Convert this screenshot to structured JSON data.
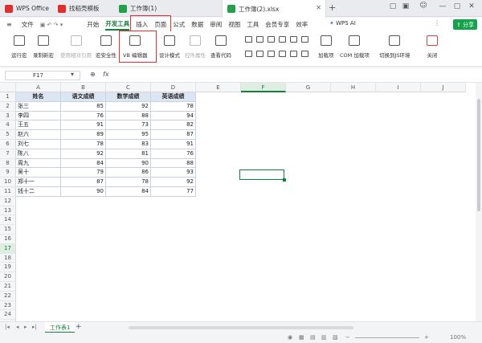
{
  "tabs": [
    {
      "label": "WPS Office",
      "color": "#e02e2e"
    },
    {
      "label": "找稻壳模板",
      "color": "#e02e2e"
    },
    {
      "label": "工作簿(1)",
      "color": "#22a04a"
    },
    {
      "label": "工作簿(2).xlsx",
      "color": "#22a04a"
    }
  ],
  "menu": {
    "file": "文件",
    "items": [
      "开始",
      "开发工具",
      "插入",
      "页面",
      "公式",
      "数据",
      "审阅",
      "视图",
      "工具",
      "会员专享",
      "效率"
    ],
    "active_index": 1,
    "wps_ai": "WPS AI",
    "share": "分享"
  },
  "ribbon": {
    "buttons": [
      {
        "label": "运行宏",
        "disabled": false
      },
      {
        "label": "录制新宏",
        "disabled": false
      },
      {
        "label": "使用相对引用",
        "disabled": true
      },
      {
        "label": "宏安全性",
        "disabled": false
      },
      {
        "label": "VB 编辑器",
        "disabled": false
      },
      {
        "label": "设计模式",
        "disabled": false
      },
      {
        "label": "控件属性",
        "disabled": true
      },
      {
        "label": "查看代码",
        "disabled": false
      },
      {
        "label": "加载项",
        "disabled": false
      },
      {
        "label": "COM 加载项",
        "disabled": false
      },
      {
        "label": "切换到JS环境",
        "disabled": false
      },
      {
        "label": "关闭",
        "disabled": false
      }
    ]
  },
  "formula_bar": {
    "cell_ref": "F17",
    "formula": ""
  },
  "grid": {
    "columns": [
      "A",
      "B",
      "C",
      "D",
      "E",
      "F",
      "G",
      "H",
      "I",
      "J"
    ],
    "selected_column": "F",
    "selected_row": 17,
    "row_count": 25,
    "table": {
      "headers": [
        "姓名",
        "语文成绩",
        "数学成绩",
        "英语成绩"
      ],
      "rows": [
        [
          "张三",
          "85",
          "92",
          "78"
        ],
        [
          "李四",
          "76",
          "88",
          "94"
        ],
        [
          "王五",
          "91",
          "73",
          "82"
        ],
        [
          "赵六",
          "89",
          "95",
          "87"
        ],
        [
          "刘七",
          "78",
          "83",
          "91"
        ],
        [
          "陈八",
          "92",
          "81",
          "76"
        ],
        [
          "周九",
          "84",
          "90",
          "88"
        ],
        [
          "吴十",
          "79",
          "86",
          "93"
        ],
        [
          "郑十一",
          "87",
          "78",
          "92"
        ],
        [
          "钱十二",
          "90",
          "84",
          "77"
        ]
      ]
    }
  },
  "sheets": {
    "active": "工作表1",
    "add_symbol": "+"
  },
  "status": {
    "zoom": "100%"
  },
  "colors": {
    "accent": "#14803c",
    "highlight": "#e03030",
    "table_header": "#dce6f2"
  }
}
